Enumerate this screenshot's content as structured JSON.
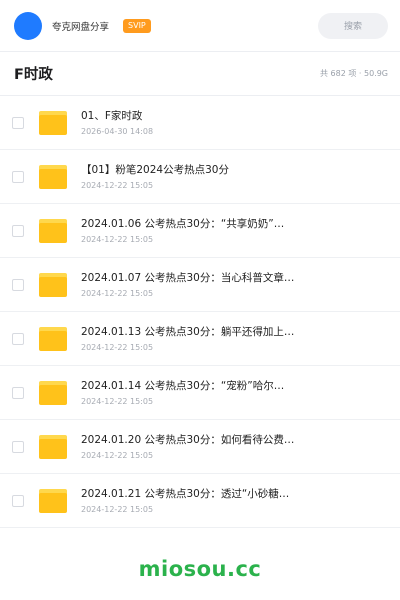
{
  "topbar": {
    "app_title": "夸克网盘分享",
    "badge": "SVIP",
    "search_label": "搜索"
  },
  "folder": {
    "title": "F时政",
    "meta": "共 682 项 · 50.9G"
  },
  "items": [
    {
      "name": "01、F家时政",
      "date": "2026-04-30 14:08"
    },
    {
      "name": "【01】粉笔2024公考热点30分",
      "date": "2024-12-22 15:05"
    },
    {
      "name": "2024.01.06 公考热点30分：“共享奶奶”…",
      "date": "2024-12-22 15:05"
    },
    {
      "name": "2024.01.07 公考热点30分：当心科普文章…",
      "date": "2024-12-22 15:05"
    },
    {
      "name": "2024.01.13 公考热点30分：躺平还得加上…",
      "date": "2024-12-22 15:05"
    },
    {
      "name": "2024.01.14 公考热点30分：“宠粉”哈尔…",
      "date": "2024-12-22 15:05"
    },
    {
      "name": "2024.01.20 公考热点30分：如何看待公费…",
      "date": "2024-12-22 15:05"
    },
    {
      "name": "2024.01.21 公考热点30分：透过“小砂糖…",
      "date": "2024-12-22 15:05"
    }
  ],
  "watermark": "miosou.cc",
  "colors": {
    "accent": "#1f7bff",
    "badge": "#ff9b1e",
    "folder": "#ffc21a",
    "watermark": "#2bb24c"
  }
}
